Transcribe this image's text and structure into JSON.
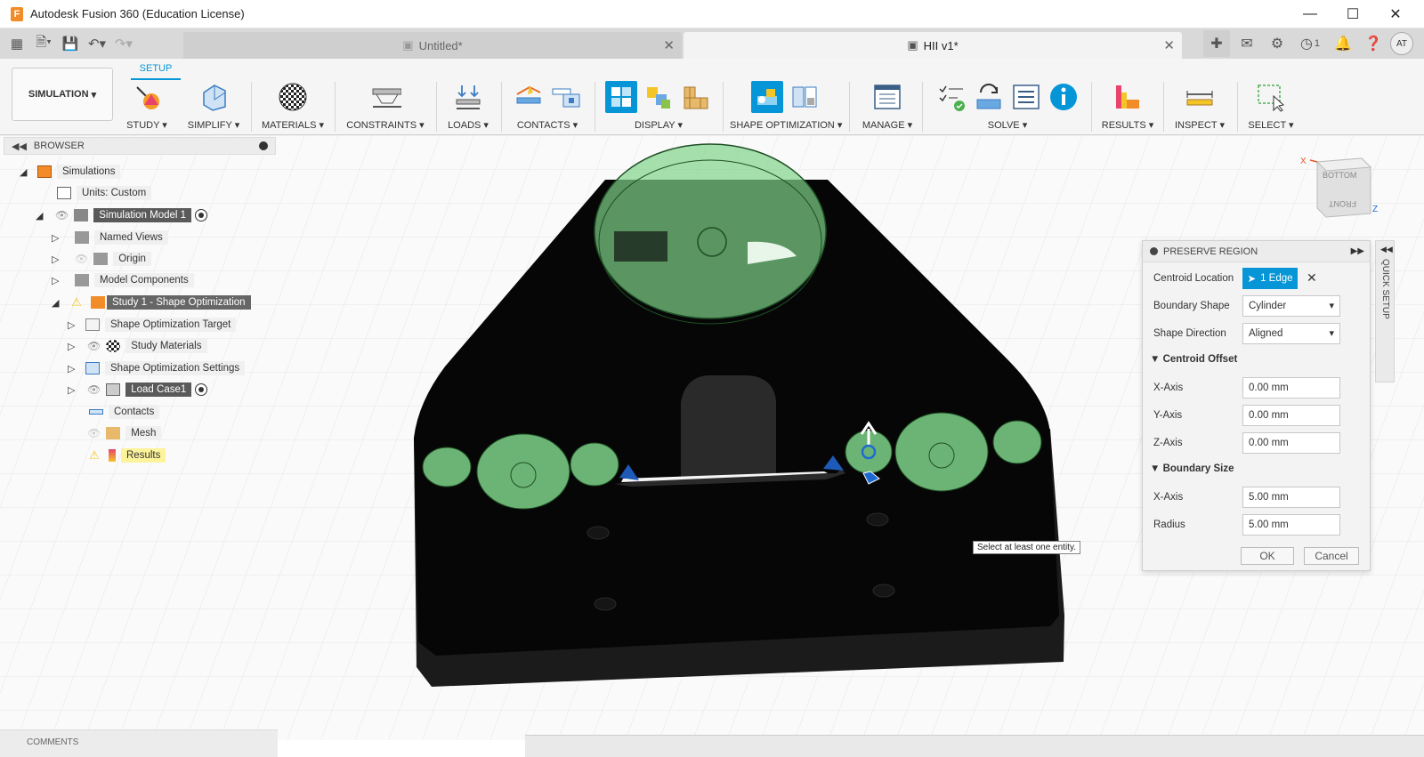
{
  "window": {
    "title": "Autodesk Fusion 360 (Education License)",
    "app_icon": "F"
  },
  "tabs": [
    {
      "label": "Untitled*",
      "active": false
    },
    {
      "label": "HII v1*",
      "active": true
    }
  ],
  "user": {
    "initials": "AT"
  },
  "notifications": {
    "job_count": "1"
  },
  "ribbon": {
    "workspace": "SIMULATION",
    "active_tab": "SETUP",
    "groups": [
      {
        "label": "STUDY"
      },
      {
        "label": "SIMPLIFY"
      },
      {
        "label": "MATERIALS"
      },
      {
        "label": "CONSTRAINTS"
      },
      {
        "label": "LOADS"
      },
      {
        "label": "CONTACTS"
      },
      {
        "label": "DISPLAY"
      },
      {
        "label": "SHAPE OPTIMIZATION"
      },
      {
        "label": "MANAGE"
      },
      {
        "label": "SOLVE"
      },
      {
        "label": "RESULTS"
      },
      {
        "label": "INSPECT"
      },
      {
        "label": "SELECT"
      }
    ]
  },
  "browser": {
    "title": "BROWSER",
    "items": [
      {
        "label": "Simulations"
      },
      {
        "label": "Units: Custom"
      },
      {
        "label": "Simulation Model 1"
      },
      {
        "label": "Named Views"
      },
      {
        "label": "Origin"
      },
      {
        "label": "Model Components"
      },
      {
        "label": "Study 1 - Shape Optimization"
      },
      {
        "label": "Shape Optimization Target"
      },
      {
        "label": "Study Materials"
      },
      {
        "label": "Shape Optimization Settings"
      },
      {
        "label": "Load Case1"
      },
      {
        "label": "Contacts"
      },
      {
        "label": "Mesh"
      },
      {
        "label": "Results"
      }
    ]
  },
  "dialog": {
    "title": "PRESERVE REGION",
    "centroid_location_label": "Centroid Location",
    "centroid_location_value": "1 Edge",
    "boundary_shape_label": "Boundary Shape",
    "boundary_shape_value": "Cylinder",
    "shape_direction_label": "Shape Direction",
    "shape_direction_value": "Aligned",
    "centroid_offset_title": "Centroid Offset",
    "x_axis_label": "X-Axis",
    "x_axis_value": "0.00 mm",
    "y_axis_label": "Y-Axis",
    "y_axis_value": "0.00 mm",
    "z_axis_label": "Z-Axis",
    "z_axis_value": "0.00 mm",
    "boundary_size_title": "Boundary Size",
    "bs_x_axis_label": "X-Axis",
    "bs_x_axis_value": "5.00 mm",
    "radius_label": "Radius",
    "radius_value": "5.00 mm",
    "ok_label": "OK",
    "cancel_label": "Cancel"
  },
  "quick_setup": "QUICK SETUP",
  "viewcube": {
    "top": "BOTTOM",
    "front": "FRONT",
    "x_axis": "X",
    "z_axis": "Z"
  },
  "tooltip": "Select at least one entity.",
  "comments": "COMMENTS"
}
